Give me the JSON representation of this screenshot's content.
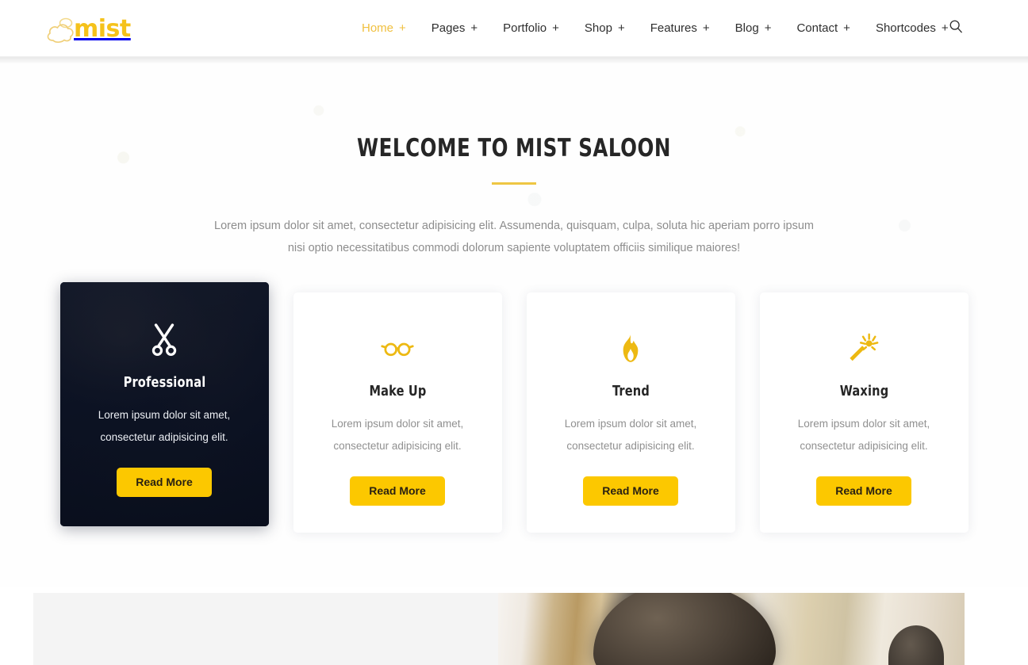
{
  "brand": {
    "logo_text": "mist",
    "logo_icon": "cloud-icon",
    "accent_color": "#f5c21b"
  },
  "header": {
    "search_icon": "search-icon",
    "nav": [
      {
        "label": "Home",
        "plus": "+",
        "active": true
      },
      {
        "label": "Pages",
        "plus": "+",
        "active": false
      },
      {
        "label": "Portfolio",
        "plus": "+",
        "active": false
      },
      {
        "label": "Shop",
        "plus": "+",
        "active": false
      },
      {
        "label": "Features",
        "plus": "+",
        "active": false
      },
      {
        "label": "Blog",
        "plus": "+",
        "active": false
      },
      {
        "label": "Contact",
        "plus": "+",
        "active": false
      },
      {
        "label": "Shortcodes",
        "plus": "+",
        "active": false
      }
    ]
  },
  "welcome": {
    "title": "WELCOME TO MIST SALOON",
    "paragraph": "Lorem ipsum dolor sit amet, consectetur adipisicing elit. Assumenda, quisquam, culpa, soluta hic aperiam porro ipsum nisi optio necessitatibus commodi dolorum sapiente voluptatem officiis similique maiores!",
    "underline_color": "#eec643"
  },
  "services": {
    "button_color": "#fcc800",
    "cards": [
      {
        "title": "Professional",
        "icon": "scissors-icon",
        "text": "Lorem ipsum dolor sit amet, consectetur adipisicing elit.",
        "button": "Read More",
        "featured": true
      },
      {
        "title": "Make Up",
        "icon": "glasses-icon",
        "text": "Lorem ipsum dolor sit amet, consectetur adipisicing elit.",
        "button": "Read More",
        "featured": false
      },
      {
        "title": "Trend",
        "icon": "flame-icon",
        "text": "Lorem ipsum dolor sit amet, consectetur adipisicing elit.",
        "button": "Read More",
        "featured": false
      },
      {
        "title": "Waxing",
        "icon": "magic-wand-icon",
        "text": "Lorem ipsum dolor sit amet, consectetur adipisicing elit.",
        "button": "Read More",
        "featured": false
      }
    ]
  },
  "banner": {
    "image_alt": "salon-haircut-photo"
  }
}
